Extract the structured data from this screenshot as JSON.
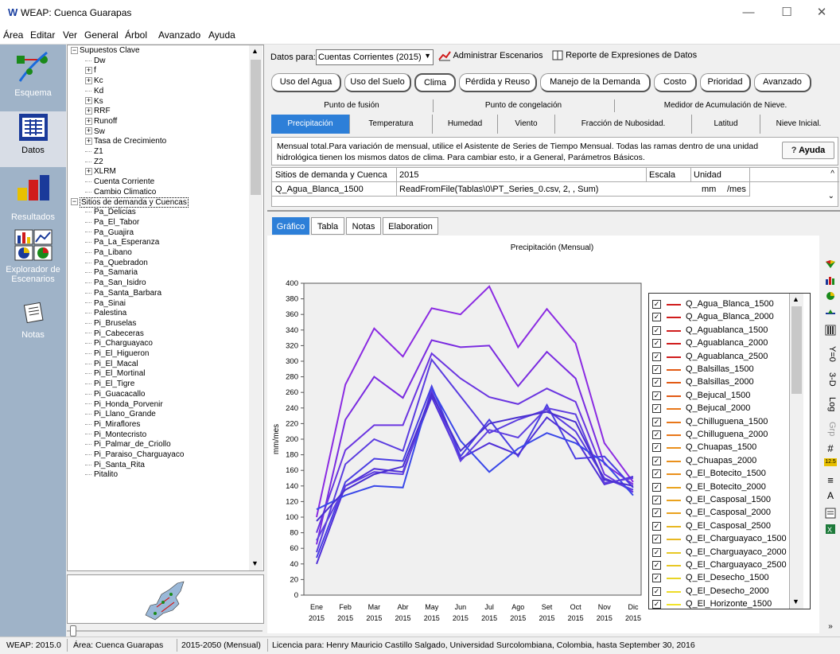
{
  "window": {
    "app_icon": "W",
    "title": "WEAP: Cuenca Guarapas"
  },
  "menu": [
    "Área",
    "Editar",
    "Ver",
    "General",
    "Árbol",
    "Avanzado",
    "Ayuda"
  ],
  "nav": [
    {
      "label": "Esquema",
      "icon": "schematic-icon"
    },
    {
      "label": "Datos",
      "icon": "data-icon"
    },
    {
      "label": "Resultados",
      "icon": "results-icon"
    },
    {
      "label": "Explorador de Escenarios",
      "icon": "scenario-explorer-icon"
    },
    {
      "label": "Notas",
      "icon": "notes-icon"
    }
  ],
  "tree": {
    "top": [
      {
        "label": "Supuestos Clave",
        "exp": "−",
        "lvl": 0
      },
      {
        "label": "Dw",
        "exp": "",
        "lvl": 1
      },
      {
        "label": "f",
        "exp": "+",
        "lvl": 1
      },
      {
        "label": "Kc",
        "exp": "+",
        "lvl": 1
      },
      {
        "label": "Kd",
        "exp": "",
        "lvl": 1
      },
      {
        "label": "Ks",
        "exp": "+",
        "lvl": 1
      },
      {
        "label": "RRF",
        "exp": "+",
        "lvl": 1
      },
      {
        "label": "Runoff",
        "exp": "+",
        "lvl": 1
      },
      {
        "label": "Sw",
        "exp": "+",
        "lvl": 1
      },
      {
        "label": "Tasa de Crecimiento",
        "exp": "+",
        "lvl": 1
      },
      {
        "label": "Z1",
        "exp": "",
        "lvl": 1
      },
      {
        "label": "Z2",
        "exp": "",
        "lvl": 1
      },
      {
        "label": "XLRM",
        "exp": "+",
        "lvl": 1
      },
      {
        "label": "Cuenta Corriente",
        "exp": "",
        "lvl": 1
      },
      {
        "label": "Cambio Climatico",
        "exp": "",
        "lvl": 1
      },
      {
        "label": "Sitios de demanda y Cuencas",
        "exp": "−",
        "lvl": 0,
        "selected": true
      }
    ],
    "sites": [
      "Pa_Delicias",
      "Pa_El_Tabor",
      "Pa_Guajira",
      "Pa_La_Esperanza",
      "Pa_Libano",
      "Pa_Quebradon",
      "Pa_Samaria",
      "Pa_San_Isidro",
      "Pa_Santa_Barbara",
      "Pa_Sinai",
      "Palestina",
      "Pi_Bruselas",
      "Pi_Cabeceras",
      "Pi_Charguayaco",
      "Pi_El_Higueron",
      "Pi_El_Macal",
      "Pi_El_Mortinal",
      "Pi_El_Tigre",
      "Pi_Guacacallo",
      "Pi_Honda_Porvenir",
      "Pi_Llano_Grande",
      "Pi_Miraflores",
      "Pi_Montecristo",
      "Pi_Palmar_de_Criollo",
      "Pi_Paraiso_Charguayaco",
      "Pi_Santa_Rita",
      "Pitalito"
    ]
  },
  "toolbar": {
    "datos_para_label": "Datos para:",
    "scenario": "Cuentas Corrientes (2015)",
    "manage": "Administrar Escenarios",
    "report": "Reporte de Expresiones de Datos"
  },
  "category_buttons": [
    "Uso del Agua",
    "Uso del Suelo",
    "Clima",
    "Pérdida y Reuso",
    "Manejo de la Demanda",
    "Costo",
    "Prioridad",
    "Avanzado"
  ],
  "tabs_row1": [
    "Punto de fusión",
    "Punto de congelación",
    "Medidor de Acumulación de Nieve."
  ],
  "tabs_row2": [
    "Precipitación",
    "Temperatura",
    "Humedad",
    "Viento",
    "Fracción de Nubosidad.",
    "Latitud",
    "Nieve Inicial."
  ],
  "info": {
    "text": "Mensual total.Para variación de mensual, utilice el Asistente de Series de Tiempo Mensual.  Todas las ramas dentro de una unidad hidrológica tienen los mismos datos de clima.  Para cambiar esto,  ir a General, Parámetros Básicos.",
    "help": "Ayuda"
  },
  "table": {
    "headers": [
      "Sitios de demanda y Cuenca",
      "2015",
      "Escala",
      "Unidad"
    ],
    "row": [
      "Q_Agua_Blanca_1500",
      "ReadFromFile(Tablas\\0\\PT_Series_0.csv, 2, , Sum)",
      "",
      "mm",
      "/mes"
    ]
  },
  "graph_tabs": [
    "Gráfico",
    "Tabla",
    "Notas",
    "Elaboration"
  ],
  "chart_data": {
    "type": "line",
    "title": "Precipitación (Mensual)",
    "ylabel": "mm/mes",
    "ylim": [
      0,
      400
    ],
    "yticks": [
      0,
      20,
      40,
      60,
      80,
      100,
      120,
      140,
      160,
      180,
      200,
      220,
      240,
      260,
      280,
      300,
      320,
      340,
      360,
      380,
      400
    ],
    "categories": [
      "Ene",
      "Feb",
      "Mar",
      "Abr",
      "May",
      "Jun",
      "Jul",
      "Ago",
      "Set",
      "Oct",
      "Nov",
      "Dic"
    ],
    "year_label": "2015",
    "series": [
      {
        "color": "#8b2be2",
        "values": [
          100,
          270,
          342,
          306,
          368,
          360,
          396,
          318,
          367,
          323,
          195,
          145
        ]
      },
      {
        "color": "#7a2be0",
        "values": [
          65,
          225,
          280,
          253,
          327,
          318,
          320,
          268,
          312,
          278,
          168,
          142
        ]
      },
      {
        "color": "#6a35e0",
        "values": [
          80,
          186,
          218,
          218,
          310,
          278,
          254,
          245,
          265,
          248,
          155,
          132
        ]
      },
      {
        "color": "#5a3ce0",
        "values": [
          55,
          168,
          200,
          185,
          302,
          255,
          208,
          225,
          238,
          210,
          150,
          135
        ]
      },
      {
        "color": "#4a3ee2",
        "values": [
          48,
          145,
          175,
          172,
          268,
          178,
          225,
          178,
          244,
          175,
          178,
          138
        ]
      },
      {
        "color": "#5030d8",
        "values": [
          40,
          140,
          162,
          158,
          254,
          175,
          195,
          180,
          228,
          200,
          142,
          152
        ]
      },
      {
        "color": "#3a48e8",
        "values": [
          110,
          128,
          140,
          138,
          265,
          198,
          158,
          188,
          208,
          195,
          170,
          128
        ]
      },
      {
        "color": "#6040e0",
        "values": [
          70,
          140,
          158,
          155,
          262,
          172,
          212,
          202,
          240,
          232,
          144,
          150
        ]
      },
      {
        "color": "#4a30d0",
        "values": [
          95,
          135,
          155,
          165,
          258,
          185,
          220,
          228,
          235,
          222,
          148,
          140
        ]
      }
    ],
    "legend": [
      {
        "name": "Q_Agua_Blanca_1500",
        "color": "#d01c1c"
      },
      {
        "name": "Q_Agua_Blanca_2000",
        "color": "#d01c1c"
      },
      {
        "name": "Q_Aguablanca_1500",
        "color": "#d01c1c"
      },
      {
        "name": "Q_Aguablanca_2000",
        "color": "#d01c1c"
      },
      {
        "name": "Q_Aguablanca_2500",
        "color": "#d01c1c"
      },
      {
        "name": "Q_Balsillas_1500",
        "color": "#e25a14"
      },
      {
        "name": "Q_Balsillas_2000",
        "color": "#e25a14"
      },
      {
        "name": "Q_Bejucal_1500",
        "color": "#e25a14"
      },
      {
        "name": "Q_Bejucal_2000",
        "color": "#e8771a"
      },
      {
        "name": "Q_Chilluguena_1500",
        "color": "#e8771a"
      },
      {
        "name": "Q_Chilluguena_2000",
        "color": "#e8771a"
      },
      {
        "name": "Q_Chuapas_1500",
        "color": "#ea901c"
      },
      {
        "name": "Q_Chuapas_2000",
        "color": "#ea901c"
      },
      {
        "name": "Q_El_Botecito_1500",
        "color": "#ea901c"
      },
      {
        "name": "Q_El_Botecito_2000",
        "color": "#eaa21e"
      },
      {
        "name": "Q_El_Casposal_1500",
        "color": "#eaa21e"
      },
      {
        "name": "Q_El_Casposal_2000",
        "color": "#eaa21e"
      },
      {
        "name": "Q_El_Casposal_2500",
        "color": "#e8b822"
      },
      {
        "name": "Q_El_Charguayaco_1500",
        "color": "#e8b822"
      },
      {
        "name": "Q_El_Charguayaco_2000",
        "color": "#e8c824"
      },
      {
        "name": "Q_El_Charguayaco_2500",
        "color": "#e8c824"
      },
      {
        "name": "Q_El_Desecho_1500",
        "color": "#e8d426"
      },
      {
        "name": "Q_El_Desecho_2000",
        "color": "#eedc28"
      },
      {
        "name": "Q_El_Horizonte_1500",
        "color": "#f2e42a"
      }
    ]
  },
  "side_tools": {
    "y0": "Y=0",
    "threed": "3-D",
    "log": "Log",
    "grp": "Grp",
    "val": "12.5"
  },
  "status": {
    "version": "WEAP: 2015.0",
    "area": "Área: Cuenca Guarapas",
    "period": "2015-2050 (Mensual)",
    "license": "Licencia para: Henry Mauricio Castillo Salgado, Universidad Surcolombiana, Colombia, hasta September 30, 2016"
  }
}
